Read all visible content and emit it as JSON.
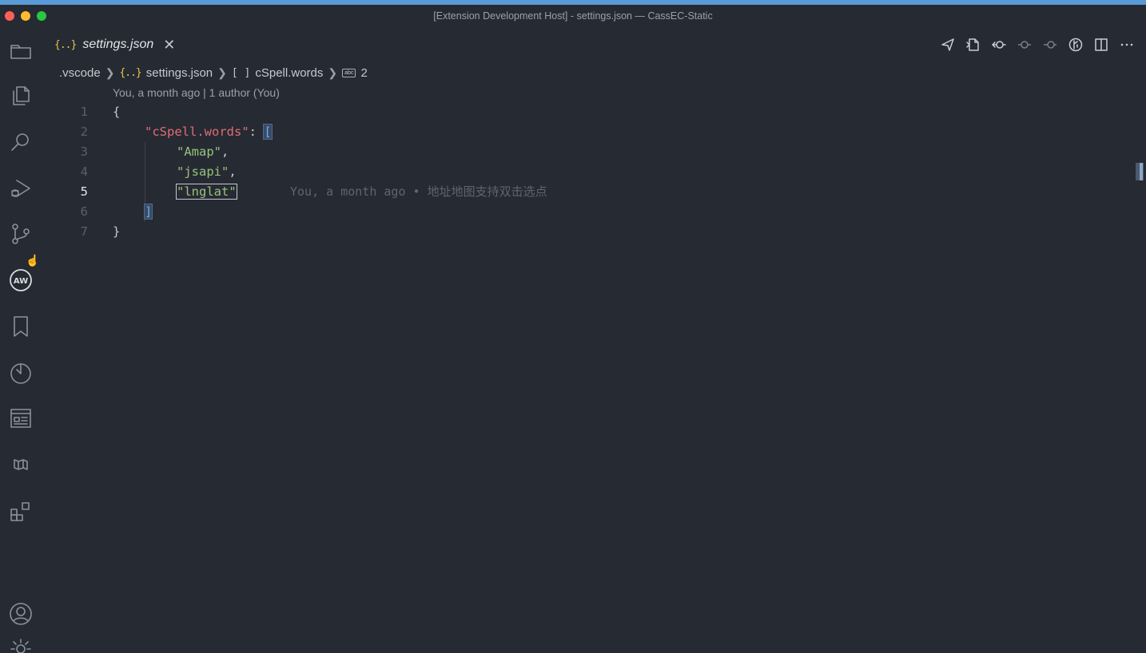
{
  "window": {
    "title": "[Extension Development Host] - settings.json — CassEC-Static"
  },
  "activity_bar": {
    "items": [
      {
        "name": "folder-icon"
      },
      {
        "name": "explorer-icon"
      },
      {
        "name": "search-icon"
      },
      {
        "name": "run-debug-icon"
      },
      {
        "name": "source-control-icon"
      },
      {
        "name": "aw-extension-icon"
      },
      {
        "name": "bookmark-icon"
      },
      {
        "name": "timeline-icon"
      },
      {
        "name": "preview-icon"
      },
      {
        "name": "book-icon"
      },
      {
        "name": "extensions-icon"
      }
    ],
    "bottom": [
      {
        "name": "account-icon"
      },
      {
        "name": "gear-icon"
      }
    ]
  },
  "tab": {
    "label": "settings.json",
    "icon": "{..}"
  },
  "breadcrumb": {
    "folder": ".vscode",
    "file": "settings.json",
    "array_icon": "[ ]",
    "array": "cSpell.words",
    "string_icon": "abc",
    "index": "2"
  },
  "codelens": "You, a month ago | 1 author (You)",
  "editor": {
    "line_numbers": [
      "1",
      "2",
      "3",
      "4",
      "5",
      "6",
      "7"
    ],
    "open_brace": "{",
    "key": "\"cSpell.words\"",
    "colon": ": ",
    "open_bracket": "[",
    "word1": "\"Amap\"",
    "word2": "\"jsapi\"",
    "word3": "\"lnglat\"",
    "comma": ",",
    "close_bracket": "]",
    "close_brace": "}",
    "blame": "You, a month ago • 地址地图支持双击选点"
  },
  "colors": {
    "background": "#262a33",
    "key": "#e06c75",
    "string": "#98c379",
    "accent": "#5a9ad6"
  }
}
